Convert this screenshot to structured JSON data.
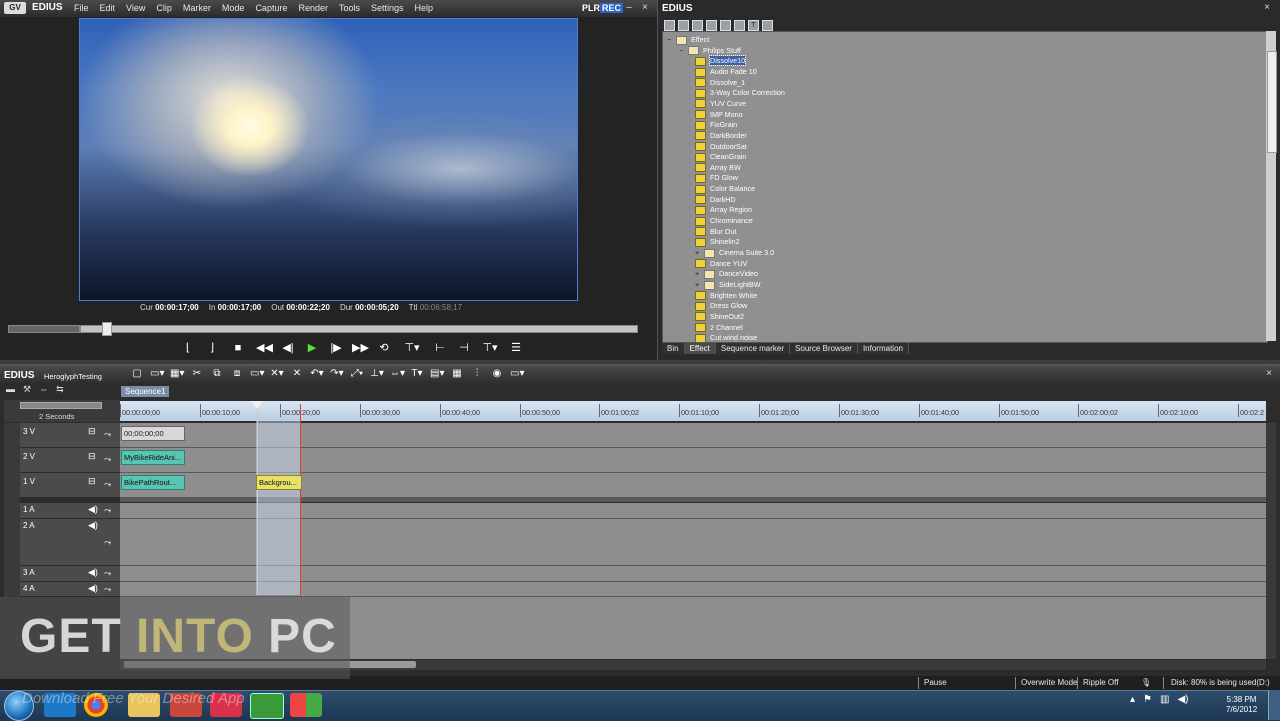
{
  "player": {
    "app_name": "EDIUS",
    "menu": [
      "File",
      "Edit",
      "View",
      "Clip",
      "Marker",
      "Mode",
      "Capture",
      "Render",
      "Tools",
      "Settings",
      "Help"
    ],
    "plr": "PLR",
    "rec": "REC",
    "timecodes": {
      "cur_label": "Cur",
      "cur_value": "00:00:17;00",
      "in_label": "In",
      "in_value": "00:00:17;00",
      "out_label": "Out",
      "out_value": "00:00:22;20",
      "dur_label": "Dur",
      "dur_value": "00:00:05;20",
      "ttl_label": "Ttl",
      "ttl_value": "00:06:58;17"
    }
  },
  "palette": {
    "title": "EDIUS",
    "tree": [
      {
        "label": "Effect",
        "kind": "folder",
        "level": 0
      },
      {
        "label": "Philips Stuff",
        "kind": "folder",
        "level": 1
      },
      {
        "label": "Dissolve10",
        "kind": "fx",
        "level": 2,
        "selected": true
      },
      {
        "label": "Audio Fade 10",
        "kind": "fx",
        "level": 2
      },
      {
        "label": "Dissolve_1",
        "kind": "fx",
        "level": 2
      },
      {
        "label": "3-Way Color Correction",
        "kind": "fx",
        "level": 2
      },
      {
        "label": "YUV Curve",
        "kind": "fx",
        "level": 2
      },
      {
        "label": "IMP Mono",
        "kind": "fx",
        "level": 2
      },
      {
        "label": "FixGrain",
        "kind": "fx",
        "level": 2
      },
      {
        "label": "DarkBorder",
        "kind": "fx",
        "level": 2
      },
      {
        "label": "OutdoorSat",
        "kind": "fx",
        "level": 2
      },
      {
        "label": "CleanGrain",
        "kind": "fx",
        "level": 2
      },
      {
        "label": "Array BW",
        "kind": "fx",
        "level": 2
      },
      {
        "label": "FD Glow",
        "kind": "fx",
        "level": 2
      },
      {
        "label": "Color Balance",
        "kind": "fx",
        "level": 2
      },
      {
        "label": "DarkHD",
        "kind": "fx",
        "level": 2
      },
      {
        "label": "Array Region",
        "kind": "fx",
        "level": 2
      },
      {
        "label": "Chrominance",
        "kind": "fx",
        "level": 2
      },
      {
        "label": "Blur Out",
        "kind": "fx",
        "level": 2
      },
      {
        "label": "Shinelin2",
        "kind": "fx",
        "level": 2
      },
      {
        "label": "Cinema Suite 3.0",
        "kind": "folder",
        "level": 2,
        "expandable": true
      },
      {
        "label": "Dance YUV",
        "kind": "fx",
        "level": 2
      },
      {
        "label": "DanceVideo",
        "kind": "folder",
        "level": 2,
        "expandable": true
      },
      {
        "label": "SideLightBW",
        "kind": "folder",
        "level": 2,
        "expandable": true
      },
      {
        "label": "Brighten White",
        "kind": "fx",
        "level": 2
      },
      {
        "label": "Dress Glow",
        "kind": "fx",
        "level": 2
      },
      {
        "label": "ShineOut2",
        "kind": "fx",
        "level": 2
      },
      {
        "label": "2 Channel",
        "kind": "fx",
        "level": 2
      },
      {
        "label": "Cut wind noise",
        "kind": "fx",
        "level": 2
      }
    ],
    "tabs": [
      "Bin",
      "Effect",
      "Sequence marker",
      "Source Browser",
      "Information"
    ],
    "active_tab": "Effect"
  },
  "timeline": {
    "app_name": "EDIUS",
    "project": "HeroglyphTesting",
    "sequence_tab": "Sequence1",
    "scale_label": "2 Seconds",
    "ruler": [
      "00:00:00;00",
      "00:00:10;00",
      "00:00:20;00",
      "00:00:30;00",
      "00:00:40;00",
      "00:00:50;00",
      "00:01:00;02",
      "00:01:10;00",
      "00:01:20;00",
      "00:01:30;00",
      "00:01:40;00",
      "00:01:50;00",
      "00:02:00;02",
      "00:02:10;00",
      "00:02:2"
    ],
    "tracks": {
      "v3": "3 V",
      "v2": "2 V",
      "v1": "1 V",
      "a1": "1 A",
      "a2": "2 A",
      "a3": "3 A",
      "a4": "4 A"
    },
    "clips": {
      "v3_clip": "00;00;00;00",
      "v2_clip": "MyBikeRideAni...",
      "v1_clip_a": "BikePathRout...",
      "v1_clip_b": "Backgrou..."
    }
  },
  "status": {
    "pause": "Pause",
    "overwrite": "Overwrite Mode",
    "ripple": "Ripple Off",
    "disk": "Disk: 80% is being used(D:)"
  },
  "taskbar": {
    "time": "5:38 PM",
    "date": "7/6/2012"
  },
  "watermark": {
    "get": "GET",
    "into": "INTO",
    "pc": "PC",
    "tagline": "Download Free Your Desired App"
  }
}
